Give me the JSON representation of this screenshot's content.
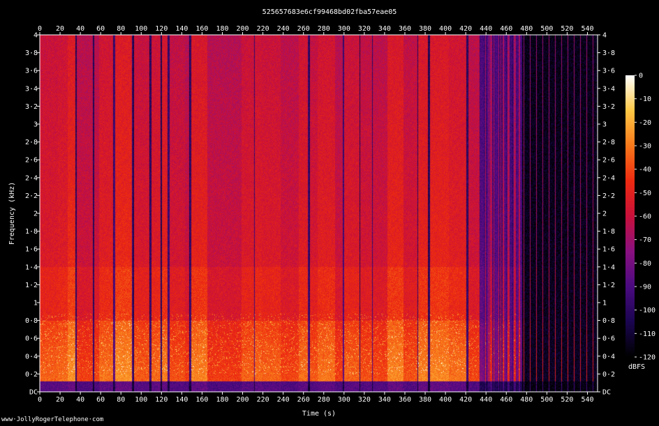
{
  "chart_data": {
    "type": "heatmap",
    "title": "525657683e6cf99468bd02fba57eae05",
    "xlabel": "Time (s)",
    "ylabel": "Frequency (kHz)",
    "x_range": [
      0,
      550
    ],
    "y_range": [
      0,
      4
    ],
    "x_ticks": [
      "0",
      "20",
      "40",
      "60",
      "80",
      "100",
      "120",
      "140",
      "160",
      "180",
      "200",
      "220",
      "240",
      "260",
      "280",
      "300",
      "320",
      "340",
      "360",
      "380",
      "400",
      "420",
      "440",
      "460",
      "480",
      "500",
      "520",
      "540"
    ],
    "x_tick_values": [
      0,
      20,
      40,
      60,
      80,
      100,
      120,
      140,
      160,
      180,
      200,
      220,
      240,
      260,
      280,
      300,
      320,
      340,
      360,
      380,
      400,
      420,
      440,
      460,
      480,
      500,
      520,
      540
    ],
    "y_ticks": [
      "DC",
      "0·2",
      "0·4",
      "0·6",
      "0·8",
      "1",
      "1·2",
      "1·4",
      "1·6",
      "1·8",
      "2",
      "2·2",
      "2·4",
      "2·6",
      "2·8",
      "3",
      "3·2",
      "3·4",
      "3·6",
      "3·8",
      "4"
    ],
    "y_tick_values": [
      0,
      0.2,
      0.4,
      0.6,
      0.8,
      1,
      1.2,
      1.4,
      1.6,
      1.8,
      2,
      2.2,
      2.4,
      2.6,
      2.8,
      3,
      3.2,
      3.4,
      3.6,
      3.8,
      4
    ],
    "colorbar": {
      "label": "dBFS",
      "range": [
        -120,
        0
      ],
      "ticks": [
        "0",
        "-10",
        "-20",
        "-30",
        "-40",
        "-50",
        "-60",
        "-70",
        "-80",
        "-90",
        "-100",
        "-110",
        "-120"
      ],
      "tick_values": [
        0,
        -10,
        -20,
        -30,
        -40,
        -50,
        -60,
        -70,
        -80,
        -90,
        -100,
        -110,
        -120
      ],
      "colors": [
        "#000000",
        "#1a0550",
        "#4a0a80",
        "#8a1080",
        "#c8103a",
        "#ee2a10",
        "#f8781a",
        "#ffc845",
        "#ffffff"
      ]
    },
    "grid": false,
    "legend": "colorbar-right"
  },
  "watermark": "www·JollyRogerTelephone·com"
}
